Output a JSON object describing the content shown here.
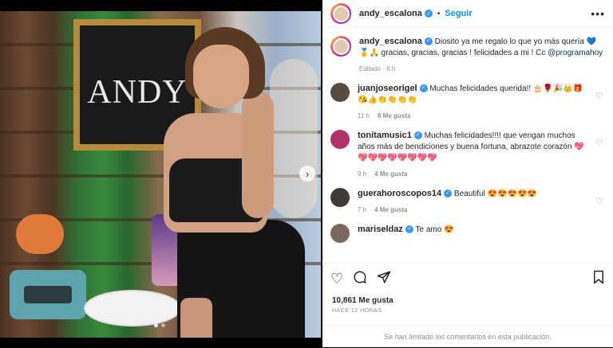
{
  "post": {
    "username": "andy_escalona",
    "follow_label": "Seguir",
    "more_label": "•••",
    "frame_text": "ANDY",
    "next_icon": "chevron-right-icon",
    "caption": {
      "username": "andy_escalona",
      "text": "Diosito ya me regalo lo que yo más quería 💙🥇🙏 gracias, gracias, gracias ! felicidades a mi ! Cc ",
      "mention": "@programahoy",
      "edited": "Editado · 6 h"
    },
    "comments": [
      {
        "username": "juanjoseorigel",
        "text": "Muchas felicidades querida!! 🎂🌹🎉👑🎁😘👍👏👏👏👏",
        "time": "11 h",
        "likes": "8 Me gusta"
      },
      {
        "username": "tonitamusic1",
        "text": "Muchas felicidades!!!! que vengan muchos años más de bendiciones y buena fortuna, abrazote corazón 💖💖💖💖💖💖💖💖💖",
        "time": "9 h",
        "likes": "4 Me gusta"
      },
      {
        "username": "guerahoroscopos14",
        "text": "Beautiful 😍😍😍😍😍",
        "time": "7 h",
        "likes": "4 Me gusta"
      },
      {
        "username": "mariseldaz",
        "text": "Te amo 😍",
        "time": "",
        "likes": ""
      }
    ],
    "likes_text": "10,861 Me gusta",
    "ago_text": "HACE 12 HORAS",
    "comments_limited": "Se han limitado los comentarios en esta publicación."
  },
  "colors": {
    "accent": "#0095f6",
    "verified": "#3897f0",
    "text": "#262626",
    "muted": "#8e8e8e"
  }
}
